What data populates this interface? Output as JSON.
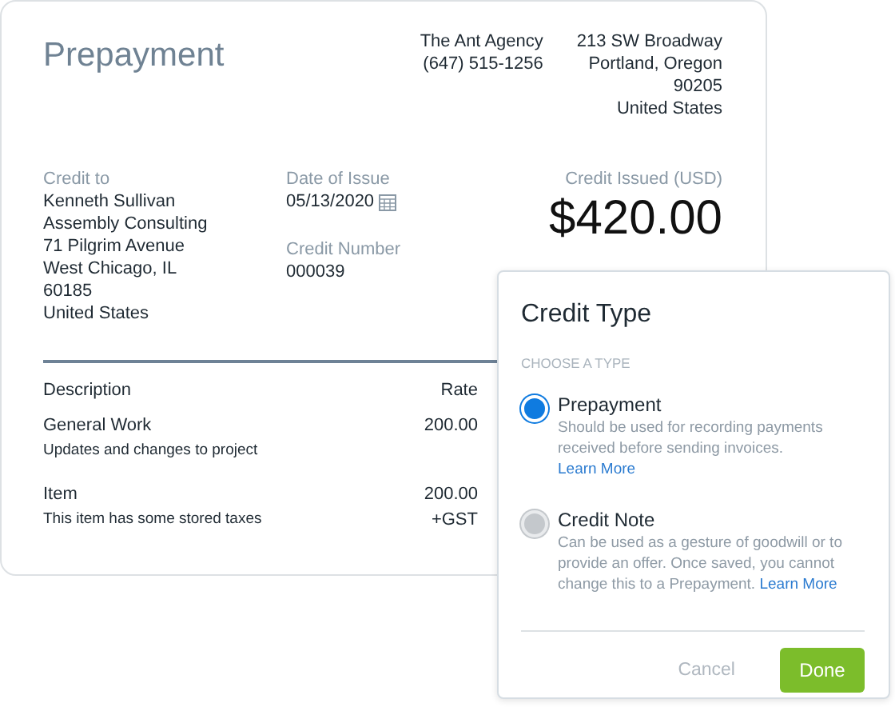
{
  "invoice": {
    "title": "Prepayment",
    "agency": [
      "The Ant Agency",
      "(647) 515-1256"
    ],
    "address": [
      "213 SW Broadway",
      "Portland, Oregon",
      "90205",
      "United States"
    ],
    "credit_to": {
      "label": "Credit to",
      "lines": [
        "Kenneth Sullivan",
        "Assembly Consulting",
        "71 Pilgrim Avenue",
        "West Chicago, IL",
        "60185",
        "United States"
      ]
    },
    "date_of_issue": {
      "label": "Date of Issue",
      "value": "05/13/2020"
    },
    "credit_number": {
      "label": "Credit Number",
      "value": "000039"
    },
    "credit_issued": {
      "label": "Credit Issued (USD)",
      "value": "$420.00"
    },
    "table": {
      "columns": [
        "Description",
        "Rate"
      ],
      "rows": [
        {
          "description": "General Work",
          "detail": "Updates and changes to project",
          "rate": "200.00",
          "note": ""
        },
        {
          "description": "Item",
          "detail": "This item has some stored taxes",
          "rate": "200.00",
          "note": "+GST"
        }
      ]
    }
  },
  "popup": {
    "title": "Credit Type",
    "section": "CHOOSE A TYPE",
    "options": [
      {
        "label": "Prepayment",
        "description": "Should be used for recording payments received before sending invoices.",
        "link": "Learn More",
        "selected": true
      },
      {
        "label": "Credit Note",
        "description": "Can be used as a gesture of goodwill or to provide an offer. Once saved, you cannot change this to a Prepayment.",
        "link": "Learn More",
        "selected": false
      }
    ],
    "buttons": {
      "cancel": "Cancel",
      "done": "Done"
    }
  }
}
